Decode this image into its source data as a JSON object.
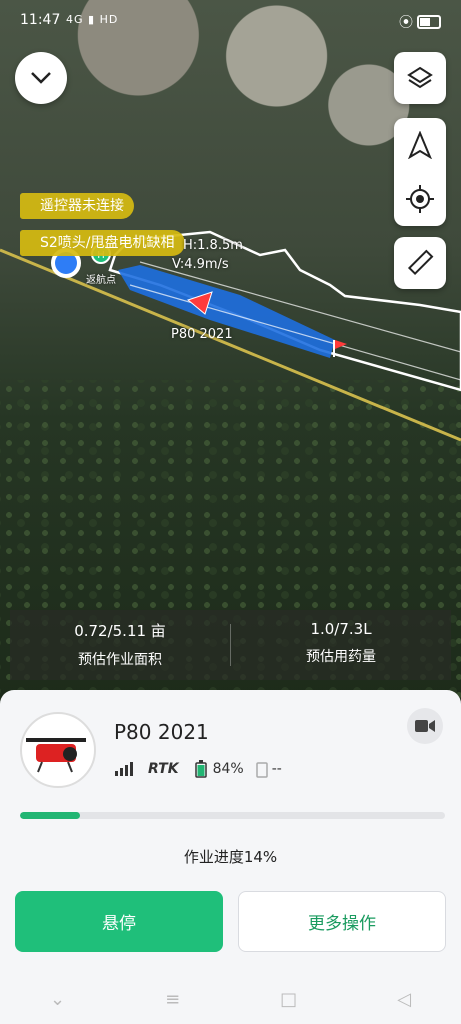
{
  "status_bar": {
    "time": "11:47",
    "network": "4G ▮ HD",
    "location_icon": "location-icon"
  },
  "map": {
    "alerts": [
      "遥控器未连接",
      "S2喷头/甩盘电机缺相"
    ],
    "labels": {
      "height": "H:1.8.5m",
      "speed": "V:4.9m/s",
      "home_point": "返航点",
      "drone": "P80 2021"
    }
  },
  "stats": {
    "area_value": "0.72/5.11 亩",
    "area_label": "预估作业面积",
    "volume_value": "1.0/7.3L",
    "volume_label": "预估用药量"
  },
  "panel": {
    "drone_name": "P80 2021",
    "battery_percent": "84%",
    "payload_value": "--",
    "rtk_label": "RTK",
    "progress_fraction": 0.14,
    "progress_text": "作业进度14%",
    "hover_button": "悬停",
    "more_button": "更多操作"
  },
  "colors": {
    "accent": "#1fbf7a",
    "alert": "#d6bb11",
    "route": "#1e6fe0"
  }
}
